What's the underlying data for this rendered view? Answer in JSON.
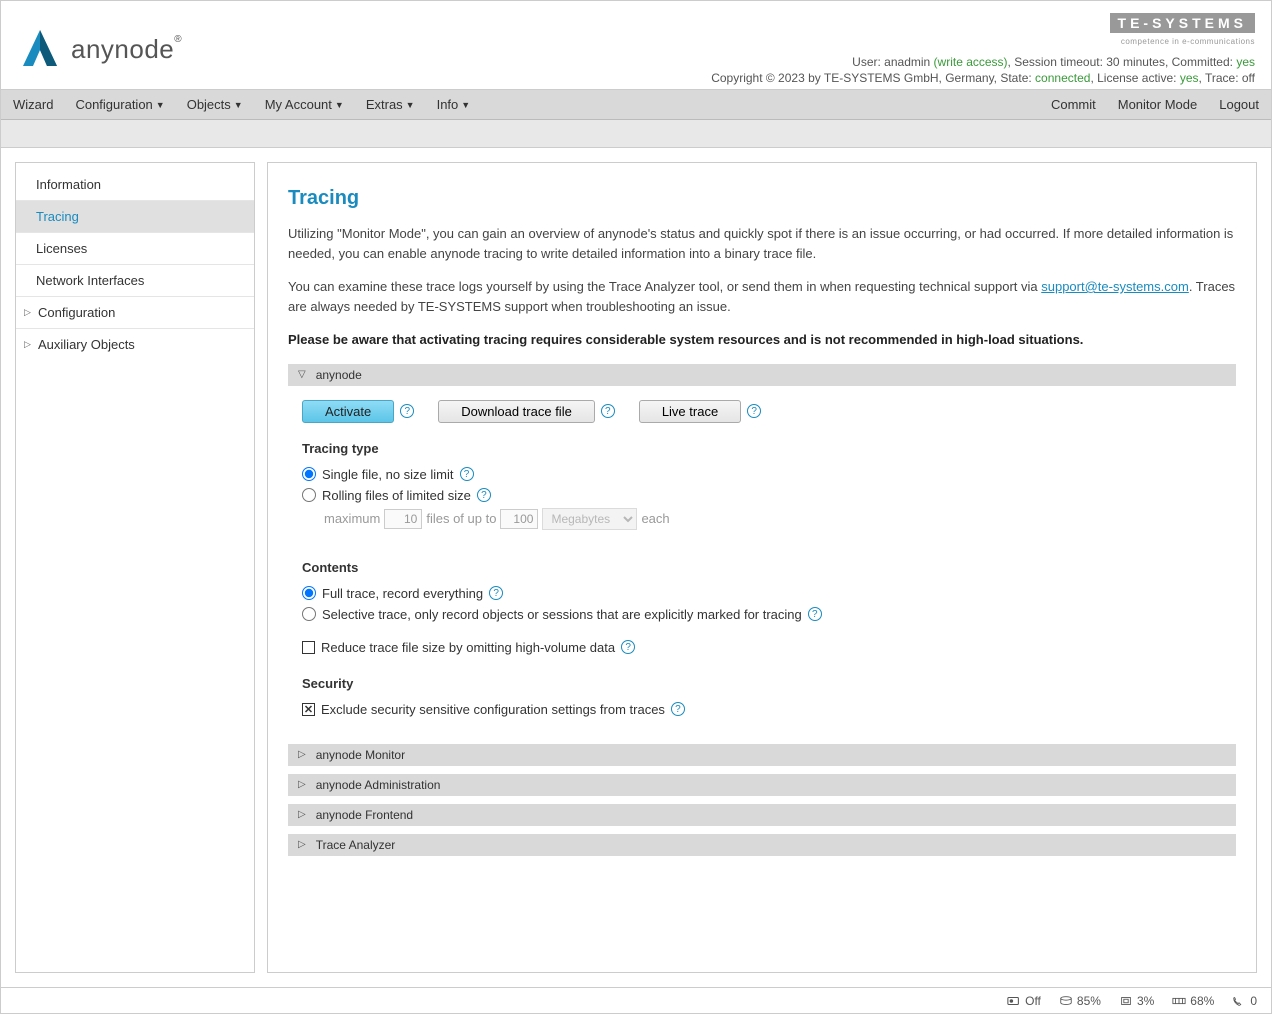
{
  "header": {
    "brand": "anynode",
    "tesys": "TE-SYSTEMS",
    "tesys_sub": "competence in e-communications",
    "user_prefix": "User: ",
    "user": "anadmin",
    "user_access": " (write access)",
    "timeout": ", Session timeout: 30 minutes, Committed: ",
    "committed": "yes",
    "copyright_prefix": "Copyright © 2023 by TE-SYSTEMS GmbH, Germany, State: ",
    "state": "connected",
    "license_prefix": ", License active: ",
    "license": "yes",
    "trace_prefix": ", Trace: ",
    "trace": "off"
  },
  "menu": {
    "wizard": "Wizard",
    "configuration": "Configuration",
    "objects": "Objects",
    "account": "My Account",
    "extras": "Extras",
    "info": "Info",
    "commit": "Commit",
    "monitor": "Monitor Mode",
    "logout": "Logout"
  },
  "sidebar": {
    "information": "Information",
    "tracing": "Tracing",
    "licenses": "Licenses",
    "network": "Network Interfaces",
    "configuration": "Configuration",
    "aux": "Auxiliary Objects"
  },
  "main": {
    "title": "Tracing",
    "para1": "Utilizing \"Monitor Mode\", you can gain an overview of anynode's status and quickly spot if there is an issue occurring, or had occurred. If more detailed information is needed, you can enable anynode tracing to write detailed information into a binary trace file.",
    "para2a": "You can examine these trace logs yourself by using the Trace Analyzer tool, or send them in when requesting technical support via ",
    "para2_link": "support@te-systems.com",
    "para2b": ". Traces are always needed by TE-SYSTEMS support when troubleshooting an issue.",
    "para3": "Please be aware that activating tracing requires considerable system resources and is not recommended in high-load situations.",
    "panel1": "anynode",
    "btn_activate": "Activate",
    "btn_download": "Download trace file",
    "btn_live": "Live trace",
    "tracing_type": "Tracing type",
    "rt_single": "Single file, no size limit",
    "rt_rolling": "Rolling files of limited size",
    "max_label": "maximum",
    "max_val": "10",
    "files_label": "files of up to",
    "size_val": "100",
    "unit": "Megabytes",
    "each": "each",
    "contents": "Contents",
    "full_trace": "Full trace, record everything",
    "selective": "Selective trace, only record objects or sessions that are explicitly marked for tracing",
    "reduce": "Reduce trace file size by omitting high-volume data",
    "security": "Security",
    "exclude": "Exclude security sensitive configuration settings from traces",
    "panel_monitor": "anynode Monitor",
    "panel_admin": "anynode Administration",
    "panel_frontend": "anynode Frontend",
    "panel_analyzer": "Trace Analyzer"
  },
  "footer": {
    "off": "Off",
    "disk": "85%",
    "cpu": "3%",
    "mem": "68%",
    "calls": "0"
  }
}
